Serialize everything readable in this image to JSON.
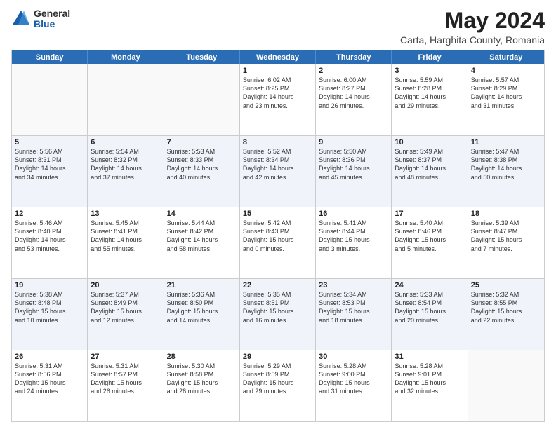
{
  "logo": {
    "general": "General",
    "blue": "Blue"
  },
  "title": "May 2024",
  "subtitle": "Carta, Harghita County, Romania",
  "days": [
    "Sunday",
    "Monday",
    "Tuesday",
    "Wednesday",
    "Thursday",
    "Friday",
    "Saturday"
  ],
  "weeks": [
    [
      {
        "day": "",
        "content": ""
      },
      {
        "day": "",
        "content": ""
      },
      {
        "day": "",
        "content": ""
      },
      {
        "day": "1",
        "content": "Sunrise: 6:02 AM\nSunset: 8:25 PM\nDaylight: 14 hours\nand 23 minutes."
      },
      {
        "day": "2",
        "content": "Sunrise: 6:00 AM\nSunset: 8:27 PM\nDaylight: 14 hours\nand 26 minutes."
      },
      {
        "day": "3",
        "content": "Sunrise: 5:59 AM\nSunset: 8:28 PM\nDaylight: 14 hours\nand 29 minutes."
      },
      {
        "day": "4",
        "content": "Sunrise: 5:57 AM\nSunset: 8:29 PM\nDaylight: 14 hours\nand 31 minutes."
      }
    ],
    [
      {
        "day": "5",
        "content": "Sunrise: 5:56 AM\nSunset: 8:31 PM\nDaylight: 14 hours\nand 34 minutes."
      },
      {
        "day": "6",
        "content": "Sunrise: 5:54 AM\nSunset: 8:32 PM\nDaylight: 14 hours\nand 37 minutes."
      },
      {
        "day": "7",
        "content": "Sunrise: 5:53 AM\nSunset: 8:33 PM\nDaylight: 14 hours\nand 40 minutes."
      },
      {
        "day": "8",
        "content": "Sunrise: 5:52 AM\nSunset: 8:34 PM\nDaylight: 14 hours\nand 42 minutes."
      },
      {
        "day": "9",
        "content": "Sunrise: 5:50 AM\nSunset: 8:36 PM\nDaylight: 14 hours\nand 45 minutes."
      },
      {
        "day": "10",
        "content": "Sunrise: 5:49 AM\nSunset: 8:37 PM\nDaylight: 14 hours\nand 48 minutes."
      },
      {
        "day": "11",
        "content": "Sunrise: 5:47 AM\nSunset: 8:38 PM\nDaylight: 14 hours\nand 50 minutes."
      }
    ],
    [
      {
        "day": "12",
        "content": "Sunrise: 5:46 AM\nSunset: 8:40 PM\nDaylight: 14 hours\nand 53 minutes."
      },
      {
        "day": "13",
        "content": "Sunrise: 5:45 AM\nSunset: 8:41 PM\nDaylight: 14 hours\nand 55 minutes."
      },
      {
        "day": "14",
        "content": "Sunrise: 5:44 AM\nSunset: 8:42 PM\nDaylight: 14 hours\nand 58 minutes."
      },
      {
        "day": "15",
        "content": "Sunrise: 5:42 AM\nSunset: 8:43 PM\nDaylight: 15 hours\nand 0 minutes."
      },
      {
        "day": "16",
        "content": "Sunrise: 5:41 AM\nSunset: 8:44 PM\nDaylight: 15 hours\nand 3 minutes."
      },
      {
        "day": "17",
        "content": "Sunrise: 5:40 AM\nSunset: 8:46 PM\nDaylight: 15 hours\nand 5 minutes."
      },
      {
        "day": "18",
        "content": "Sunrise: 5:39 AM\nSunset: 8:47 PM\nDaylight: 15 hours\nand 7 minutes."
      }
    ],
    [
      {
        "day": "19",
        "content": "Sunrise: 5:38 AM\nSunset: 8:48 PM\nDaylight: 15 hours\nand 10 minutes."
      },
      {
        "day": "20",
        "content": "Sunrise: 5:37 AM\nSunset: 8:49 PM\nDaylight: 15 hours\nand 12 minutes."
      },
      {
        "day": "21",
        "content": "Sunrise: 5:36 AM\nSunset: 8:50 PM\nDaylight: 15 hours\nand 14 minutes."
      },
      {
        "day": "22",
        "content": "Sunrise: 5:35 AM\nSunset: 8:51 PM\nDaylight: 15 hours\nand 16 minutes."
      },
      {
        "day": "23",
        "content": "Sunrise: 5:34 AM\nSunset: 8:53 PM\nDaylight: 15 hours\nand 18 minutes."
      },
      {
        "day": "24",
        "content": "Sunrise: 5:33 AM\nSunset: 8:54 PM\nDaylight: 15 hours\nand 20 minutes."
      },
      {
        "day": "25",
        "content": "Sunrise: 5:32 AM\nSunset: 8:55 PM\nDaylight: 15 hours\nand 22 minutes."
      }
    ],
    [
      {
        "day": "26",
        "content": "Sunrise: 5:31 AM\nSunset: 8:56 PM\nDaylight: 15 hours\nand 24 minutes."
      },
      {
        "day": "27",
        "content": "Sunrise: 5:31 AM\nSunset: 8:57 PM\nDaylight: 15 hours\nand 26 minutes."
      },
      {
        "day": "28",
        "content": "Sunrise: 5:30 AM\nSunset: 8:58 PM\nDaylight: 15 hours\nand 28 minutes."
      },
      {
        "day": "29",
        "content": "Sunrise: 5:29 AM\nSunset: 8:59 PM\nDaylight: 15 hours\nand 29 minutes."
      },
      {
        "day": "30",
        "content": "Sunrise: 5:28 AM\nSunset: 9:00 PM\nDaylight: 15 hours\nand 31 minutes."
      },
      {
        "day": "31",
        "content": "Sunrise: 5:28 AM\nSunset: 9:01 PM\nDaylight: 15 hours\nand 32 minutes."
      },
      {
        "day": "",
        "content": ""
      }
    ]
  ]
}
